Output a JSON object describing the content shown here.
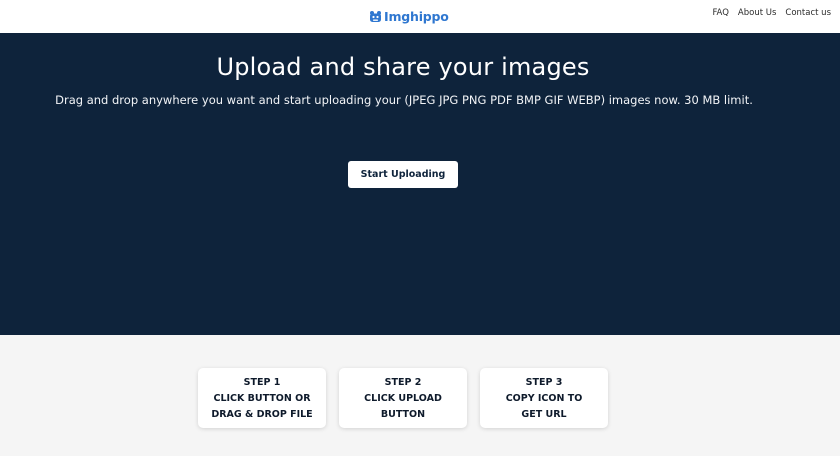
{
  "header": {
    "logo_text": "Imghippo",
    "nav": [
      "FAQ",
      "About Us",
      "Contact us"
    ]
  },
  "hero": {
    "title": "Upload and share your images",
    "subtitle": "Drag and drop anywhere you want and start uploading your (JPEG JPG PNG PDF BMP GIF WEBP) images now. 30 MB limit.",
    "button_label": "Start Uploading"
  },
  "steps": [
    {
      "label": "STEP 1",
      "line1": "CLICK BUTTON OR",
      "line2": "DRAG & DROP FILE"
    },
    {
      "label": "STEP 2",
      "line1": "CLICK UPLOAD",
      "line2": "BUTTON"
    },
    {
      "label": "STEP 3",
      "line1": "COPY ICON TO",
      "line2": "GET URL"
    }
  ],
  "colors": {
    "hero_bg": "#0e233b",
    "brand": "#2f77d0",
    "page_bg": "#f5f5f5"
  },
  "icons": {
    "logo": "hippo-logo-icon"
  }
}
